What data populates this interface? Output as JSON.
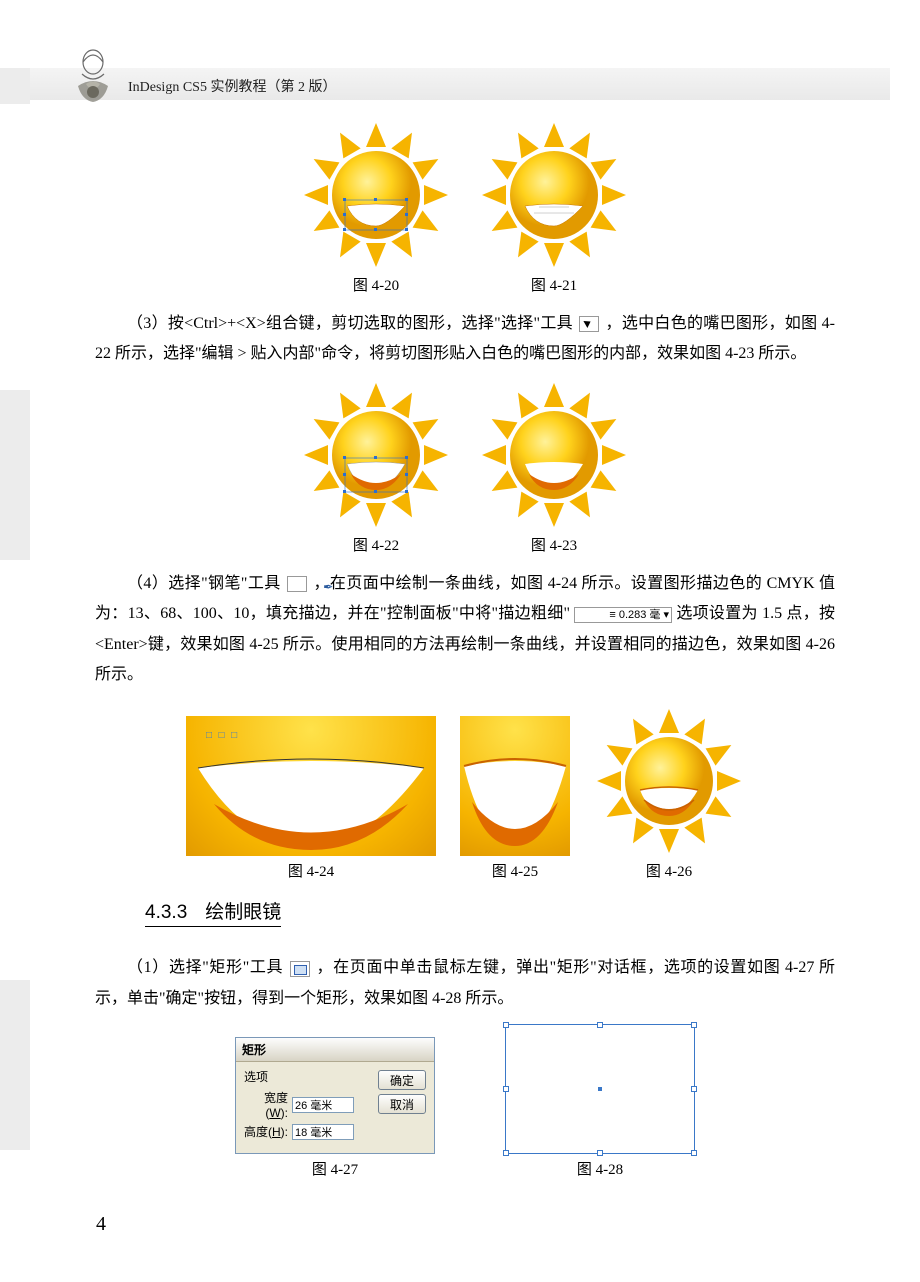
{
  "header": {
    "title": "InDesign CS5 实例教程（第 2 版）"
  },
  "captions": {
    "c420": "图 4-20",
    "c421": "图 4-21",
    "c422": "图 4-22",
    "c423": "图 4-23",
    "c424": "图 4-24",
    "c425": "图 4-25",
    "c426": "图 4-26",
    "c427": "图 4-27",
    "c428": "图 4-28"
  },
  "paras": {
    "p3a": "（3）按<Ctrl>+<X>组合键，剪切选取的图形，选择\"选择\"工具",
    "p3b": "，选中白色的嘴巴图形，如图 4-22 所示，选择\"编辑 > 贴入内部\"命令，将剪切图形贴入白色的嘴巴图形的内部，效果如图 4-23 所示。",
    "p4a": "（4）选择\"钢笔\"工具",
    "p4b": "，在页面中绘制一条曲线，如图 4-24 所示。设置图形描边色的 CMYK 值为：13、68、100、10，填充描边，并在\"控制面板\"中将\"描边粗细\"",
    "p4c": "选项设置为 1.5 点，按<Enter>键，效果如图 4-25 所示。使用相同的方法再绘制一条曲线，并设置相同的描边色，效果如图 4-26 所示。",
    "stroke_value": "0.283 毫",
    "section_num": "4.3.3",
    "section_title": "绘制眼镜",
    "p5a": "（1）选择\"矩形\"工具",
    "p5b": "，在页面中单击鼠标左键，弹出\"矩形\"对话框，选项的设置如图 4-27 所示，单击\"确定\"按钮，得到一个矩形，效果如图 4-28 所示。"
  },
  "dialog": {
    "title": "矩形",
    "group": "选项",
    "width_label_prefix": "宽度(",
    "width_label_u": "W",
    "width_label_suffix": "):",
    "height_label_prefix": "高度(",
    "height_label_u": "H",
    "height_label_suffix": "):",
    "width_value": "26 毫米",
    "height_value": "18 毫米",
    "ok": "确定",
    "cancel": "取消"
  },
  "page_number": "4"
}
